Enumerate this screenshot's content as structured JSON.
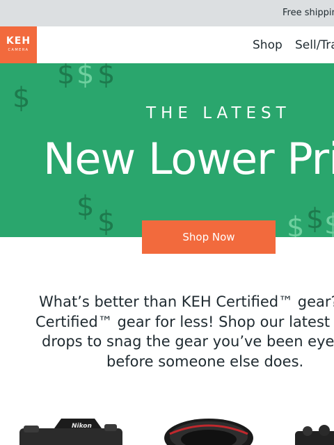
{
  "topbar": {
    "text": "Free shipping"
  },
  "logo": {
    "main": "KEH",
    "sub": "CAMERA"
  },
  "nav": {
    "shop": "Shop",
    "sell": "Sell/Trade"
  },
  "hero": {
    "kicker": "THE LATEST",
    "title": "New Lower Prices",
    "cta": "Shop Now",
    "dollar_glyph": "$",
    "colors": {
      "background": "#2aa66d",
      "dark_glyph": "#1d7a4d",
      "light_glyph": "#6fd09f",
      "cta": "#f26a3d"
    }
  },
  "intro": {
    "lines": [
      "What’s better than KEH Certified™ gear? KEH",
      "Certified™ gear for less! Shop our latest price",
      "drops to snag the gear you’ve been eyeing",
      "before someone else does."
    ]
  },
  "products": [
    {
      "name": "Nikon"
    },
    {
      "name": "lens"
    },
    {
      "name": "camera"
    }
  ]
}
